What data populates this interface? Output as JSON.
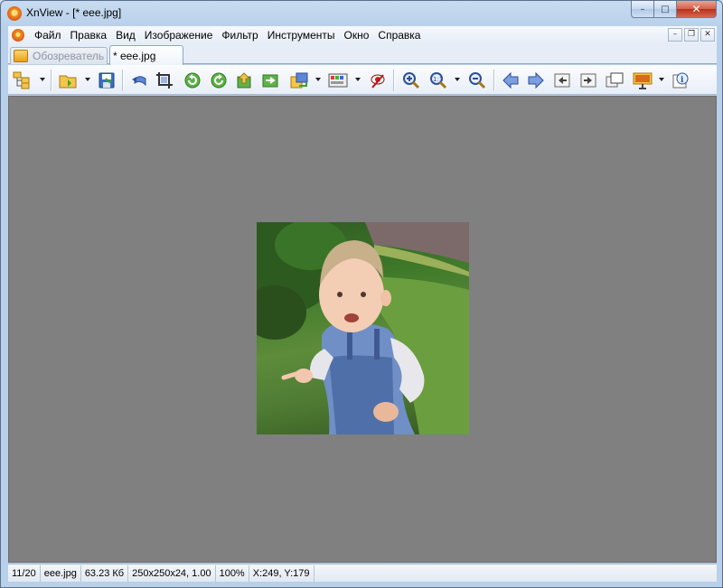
{
  "window": {
    "title": "XnView - [* eee.jpg]",
    "caption_buttons": {
      "minimize": "–",
      "maximize": "□",
      "close": "✕"
    }
  },
  "menubar": {
    "items": [
      "Файл",
      "Правка",
      "Вид",
      "Изображение",
      "Фильтр",
      "Инструменты",
      "Окно",
      "Справка"
    ],
    "mdi_buttons": {
      "minimize": "–",
      "restore": "❐",
      "close": "✕"
    }
  },
  "tabs": [
    {
      "label": "Обозреватель",
      "icon": "browser-icon",
      "active": false
    },
    {
      "label": "* eee.jpg",
      "icon": "photo-thumbnail-icon",
      "active": true
    }
  ],
  "toolbar": {
    "buttons": [
      "browser-tree-icon",
      "open-folder-icon",
      "save-icon",
      "undo-icon",
      "crop-icon",
      "rotate-left-icon",
      "rotate-right-icon",
      "export-icon",
      "convert-icon",
      "resize-icon",
      "color-adjust-icon",
      "red-eye-icon",
      "zoom-in-icon",
      "zoom-fit-icon",
      "zoom-out-icon",
      "previous-icon",
      "next-icon",
      "first-icon",
      "last-icon",
      "fullscreen-icon",
      "slideshow-icon",
      "info-icon"
    ]
  },
  "viewer": {
    "background_color": "#808080",
    "image_alt": "eee.jpg"
  },
  "statusbar": {
    "index": "11/20",
    "filename": "eee.jpg",
    "filesize": "63.23 Кб",
    "dimensions": "250x250x24, 1.00",
    "zoom": "100%",
    "cursor": "X:249, Y:179"
  }
}
